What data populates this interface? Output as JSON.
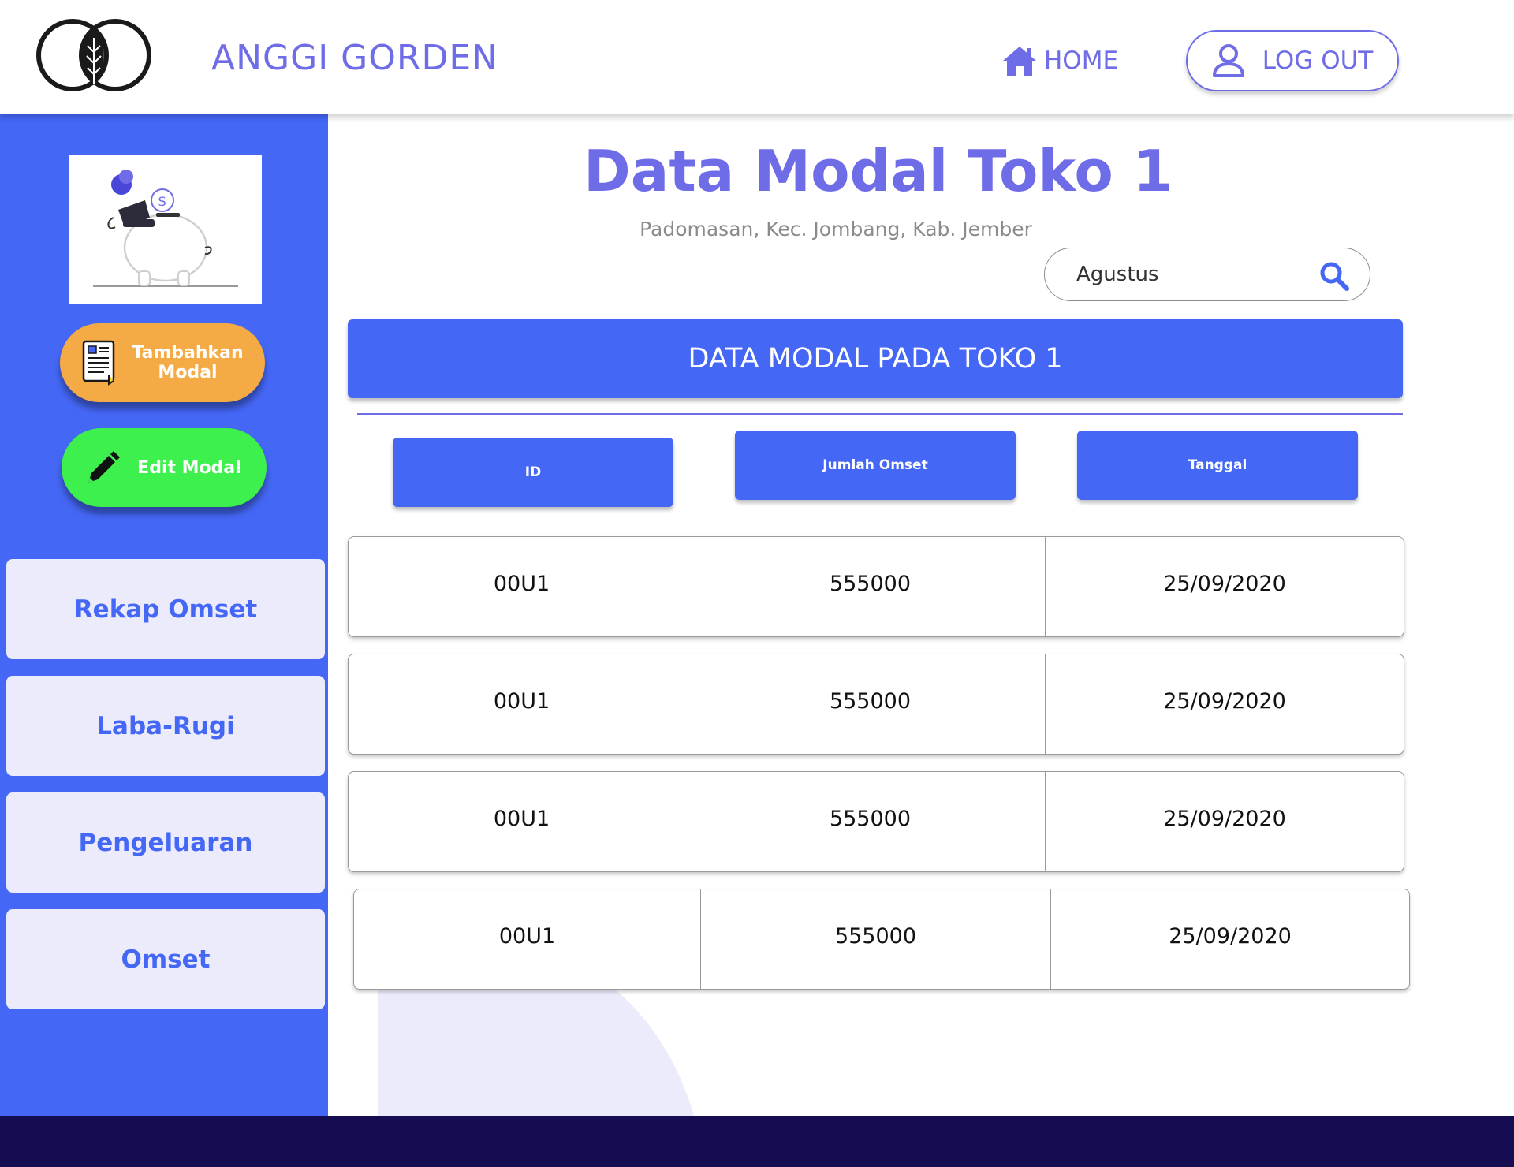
{
  "header": {
    "brand": "ANGGI GORDEN",
    "home_label": "HOME",
    "logout_label": "LOG OUT"
  },
  "sidebar": {
    "actions": [
      {
        "label": "Tambahkan Modal",
        "color": "#f4aa45",
        "icon": "document-icon"
      },
      {
        "label": "Edit Modal",
        "color": "#3ef04d",
        "icon": "pencil-icon"
      }
    ],
    "nav": [
      {
        "label": "Rekap Omset"
      },
      {
        "label": "Laba-Rugi"
      },
      {
        "label": "Pengeluaran"
      },
      {
        "label": "Omset"
      }
    ]
  },
  "main": {
    "title": "Data Modal Toko 1",
    "subtitle": "Padomasan, Kec. Jombang, Kab. Jember",
    "search": {
      "value": "Agustus"
    },
    "banner": "DATA MODAL PADA TOKO 1",
    "columns": [
      "ID",
      "Jumlah Omset",
      "Tanggal"
    ],
    "rows": [
      [
        "00U1",
        "555000",
        "25/09/2020"
      ],
      [
        "00U1",
        "555000",
        "25/09/2020"
      ],
      [
        "00U1",
        "555000",
        "25/09/2020"
      ],
      [
        "00U1",
        "555000",
        "25/09/2020"
      ]
    ]
  },
  "colors": {
    "accent": "#6f6ce8",
    "primary_blue": "#4467f5",
    "footer": "#160c52",
    "nav_bg": "#ecebfb"
  }
}
